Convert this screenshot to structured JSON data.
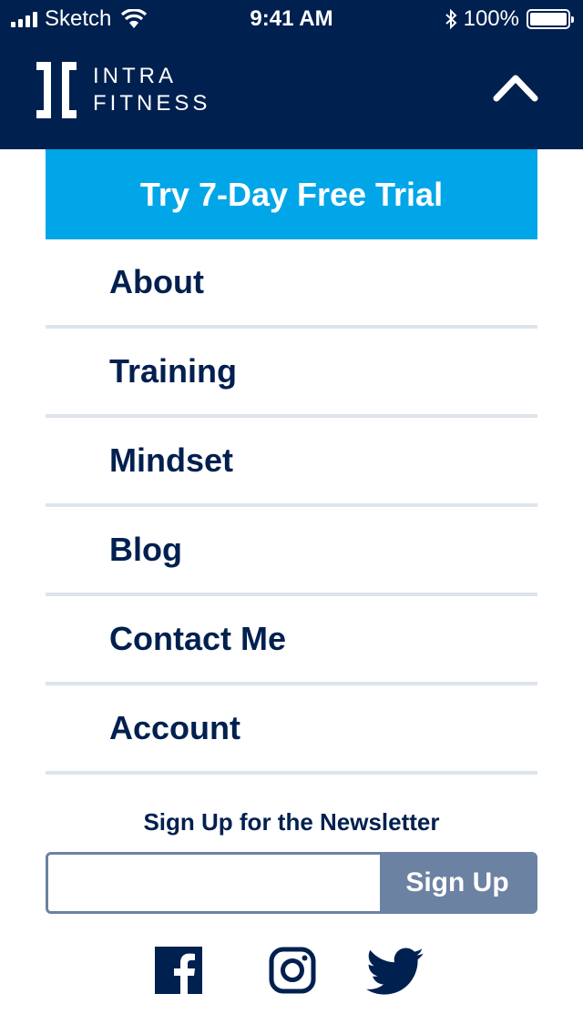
{
  "status_bar": {
    "carrier": "Sketch",
    "time": "9:41 AM",
    "battery": "100%"
  },
  "brand": {
    "line1": "INTRA",
    "line2": "FITNESS"
  },
  "cta": {
    "label": "Try 7-Day Free Trial"
  },
  "menu": {
    "items": [
      {
        "label": "About"
      },
      {
        "label": "Training"
      },
      {
        "label": "Mindset"
      },
      {
        "label": "Blog"
      },
      {
        "label": "Contact Me"
      },
      {
        "label": "Account"
      }
    ]
  },
  "newsletter": {
    "title": "Sign Up for the Newsletter",
    "email_value": "",
    "button_label": "Sign Up"
  },
  "social": {
    "icons": [
      "facebook-icon",
      "instagram-icon",
      "twitter-icon"
    ]
  },
  "colors": {
    "navy": "#00204f",
    "cta_blue": "#00a6e8",
    "slate": "#6b82a2",
    "divider": "#dde4ec"
  }
}
